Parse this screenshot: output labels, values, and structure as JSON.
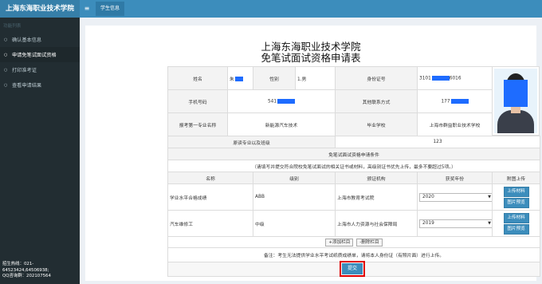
{
  "header": {
    "brand": "上海东海职业技术学院",
    "menu_toggle": "≡",
    "active_tab": "学生信息"
  },
  "sidebar": {
    "section_label": "功能列表",
    "items": [
      {
        "label": "确认基本信息",
        "icon": "circle-outline-icon"
      },
      {
        "label": "申请免笔试面试资格",
        "icon": "circle-outline-icon"
      },
      {
        "label": "打印准考证",
        "icon": "circle-outline-icon"
      },
      {
        "label": "查看申请结果",
        "icon": "circle-outline-icon"
      }
    ],
    "hotline": {
      "line1": "招生热线：021-",
      "line2": "64523424,64506938;",
      "line3": "QQ咨询群：202107564"
    }
  },
  "form": {
    "title_line1": "上海东海职业技术学院",
    "title_line2": "免笔试面试资格申请表",
    "name_label": "姓名",
    "name_value": "朱",
    "gender_label": "性别",
    "gender_value": "1.男",
    "id_label": "身份证号",
    "id_value_prefix": "3101",
    "id_value_suffix": "6016",
    "phone_label": "手机号码",
    "phone_value": "541",
    "other_contact_label": "其他联系方式",
    "other_contact_value": "177",
    "major_label": "报考第一专业名称",
    "major_value": "新能源汽车技术",
    "school_label": "毕业学校",
    "school_value": "上海市群益职业技术学校",
    "class_label": "原读专业以及班级",
    "class_value": "123",
    "conditions_header": "免笔试面试资格申请条件",
    "conditions_note": "（请填写并提交符合院校免笔试面试的相关证书或材料，高级别证书优先上传，最多不要超过5项。）",
    "table_headers": [
      "名称",
      "级别",
      "颁证机构",
      "获奖年份",
      "附图上传"
    ],
    "rows": [
      {
        "name": "学业水平合格成绩",
        "level": "ABB",
        "issuer": "上海市教育考试院",
        "year": "2020"
      },
      {
        "name": "汽车维修工",
        "level": "中级",
        "issuer": "上海市人力资源与社会保障局",
        "year": "2019"
      }
    ],
    "upload_label": "上传材料",
    "preview_label": "图片预览",
    "add_row_label": "+添加栏目",
    "remove_row_label": "-删除栏目",
    "remark": "备注：考生无法提供学业水平考试纸质成绩单，请将本人身份证（有照片面）进行上传。",
    "submit_label": "提交"
  },
  "colors": {
    "header_blue": "#3c8dbc",
    "sidebar_dark": "#222d32",
    "mask_blue": "#1e6cff",
    "warning_red": "#e00000"
  }
}
